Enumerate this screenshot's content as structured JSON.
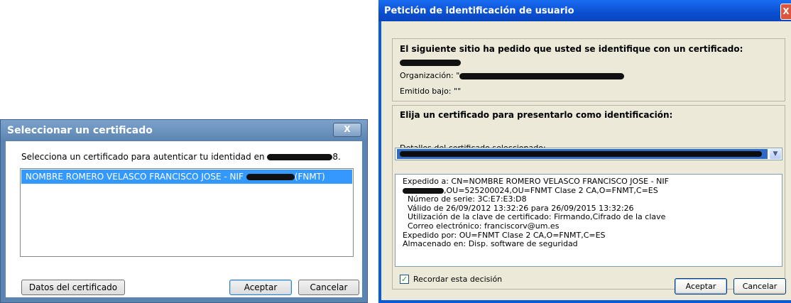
{
  "dialog1": {
    "title": "Seleccionar un certificado",
    "prompt_prefix": "Selecciona un certificado para autenticar tu identidad en",
    "prompt_suffix": "8.",
    "cert_item_prefix": "NOMBRE ROMERO VELASCO FRANCISCO JOSE - NIF",
    "cert_item_suffix": "(FNMT)",
    "close_label": "X",
    "buttons": {
      "details": "Datos del certificado",
      "accept": "Aceptar",
      "cancel": "Cancelar"
    }
  },
  "dialog2": {
    "title": "Petición de identificación de usuario",
    "close_label": "X",
    "request_heading": "El siguiente sitio ha pedido que usted se identifique con un certificado:",
    "organization_label": "Organización: \"",
    "issued_under": "Emitido bajo: \"\"",
    "choose_heading": "Elija un certificado para presentarlo como identificación:",
    "details_label": "Detalles del certificado seleccionado:",
    "details": {
      "issued_to": "Expedido a: CN=NOMBRE ROMERO VELASCO FRANCISCO JOSE - NIF",
      "issued_to_cont": ",OU=525200024,OU=FNMT Clase 2 CA,O=FNMT,C=ES",
      "serial": "Número de serie: 3C:E7:E3:D8",
      "validity": "Válido de 26/09/2012 13:32:26 para 26/09/2015 13:32:26",
      "key_usage": "Utilización de la clave de certificado: Firmando,Cifrado de la clave",
      "email": "Correo electrónico: franciscorv@um.es",
      "issued_by": "Expedido por: OU=FNMT Clase 2 CA,O=FNMT,C=ES",
      "stored_in": "Almacenado en: Disp. software de seguridad"
    },
    "remember_label": "Recordar esta decisión",
    "remember_checked": true,
    "buttons": {
      "accept": "Aceptar",
      "cancel": "Cancelar"
    }
  }
}
